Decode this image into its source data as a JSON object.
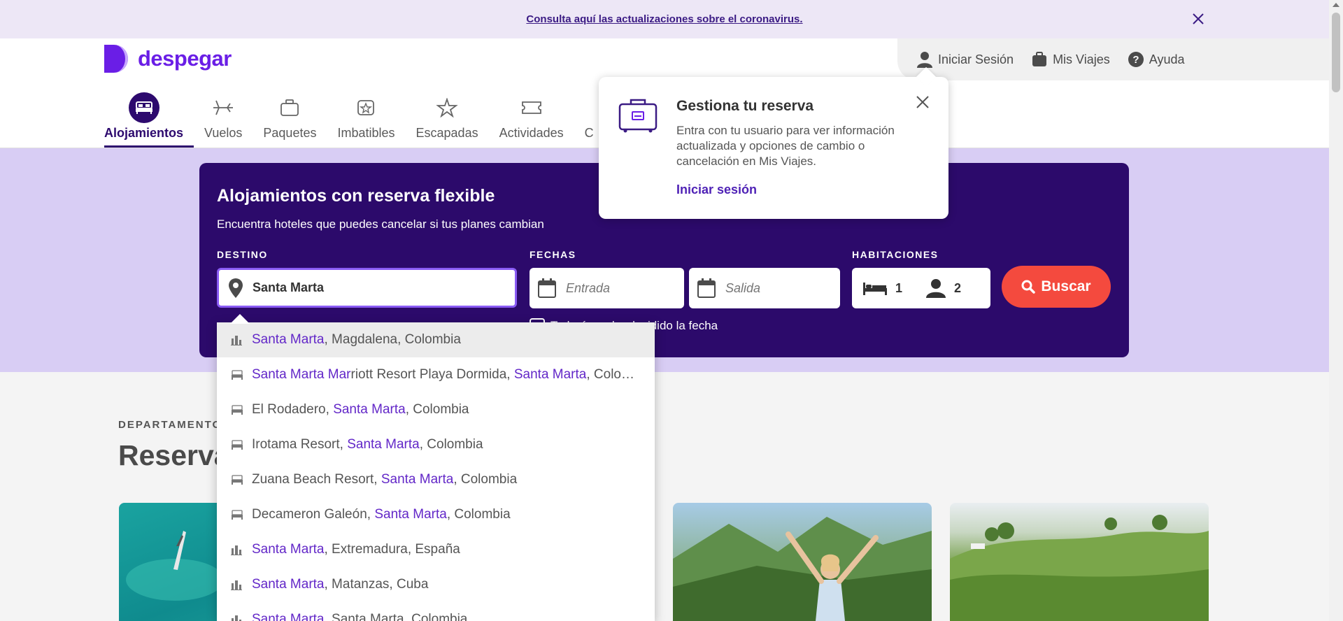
{
  "covid_bar": {
    "link_text": "Consulta aquí las actualizaciones sobre el coronavirus."
  },
  "header": {
    "logo_text": "despegar",
    "user_menu": [
      {
        "label": "Iniciar Sesión",
        "icon": "user-icon"
      },
      {
        "label": "Mis Viajes",
        "icon": "suitcase-icon"
      },
      {
        "label": "Ayuda",
        "icon": "help-icon"
      }
    ],
    "nav": [
      {
        "label": "Alojamientos",
        "icon": "bed-icon",
        "active": true
      },
      {
        "label": "Vuelos",
        "icon": "plane-icon"
      },
      {
        "label": "Paquetes",
        "icon": "package-icon"
      },
      {
        "label": "Imbatibles",
        "icon": "badge-icon"
      },
      {
        "label": "Escapadas",
        "icon": "star-icon"
      },
      {
        "label": "Actividades",
        "icon": "ticket-icon"
      },
      {
        "label": "C",
        "icon": ""
      }
    ]
  },
  "search": {
    "title": "Alojamientos con reserva flexible",
    "subtitle": "Encuentra hoteles que puedes cancelar si tus planes cambian",
    "destination_label": "DESTINO",
    "destination_value": "Santa Marta",
    "dates_label": "FECHAS",
    "checkin_placeholder": "Entrada",
    "checkout_placeholder": "Salida",
    "rooms_label": "HABITACIONES",
    "rooms_count": "1",
    "guests_count": "2",
    "search_button": "Buscar",
    "flexible_date_text": "Todavía no he decidido la fecha"
  },
  "suggestions": [
    {
      "type": "city",
      "hl": "Santa Marta",
      "rest": ", Magdalena, Colombia"
    },
    {
      "type": "hotel",
      "parts": [
        [
          "Santa Marta Mar",
          true
        ],
        [
          "riott Resort Playa Dormida, ",
          false
        ],
        [
          "Santa Marta",
          true
        ],
        [
          ", Colombia",
          false
        ]
      ]
    },
    {
      "type": "hotel",
      "parts": [
        [
          "El Rodadero, ",
          false
        ],
        [
          "Santa Marta",
          true
        ],
        [
          ", Colombia",
          false
        ]
      ]
    },
    {
      "type": "hotel",
      "parts": [
        [
          "Irotama Resort, ",
          false
        ],
        [
          "Santa Marta",
          true
        ],
        [
          ", Colombia",
          false
        ]
      ]
    },
    {
      "type": "hotel",
      "parts": [
        [
          "Zuana Beach Resort, ",
          false
        ],
        [
          "Santa Marta",
          true
        ],
        [
          ", Colombia",
          false
        ]
      ]
    },
    {
      "type": "hotel",
      "parts": [
        [
          "Decameron Galeón, ",
          false
        ],
        [
          "Santa Marta",
          true
        ],
        [
          ", Colombia",
          false
        ]
      ]
    },
    {
      "type": "city",
      "parts": [
        [
          "Santa Marta",
          true
        ],
        [
          ", Extremadura, España",
          false
        ]
      ]
    },
    {
      "type": "city",
      "parts": [
        [
          "Santa Marta",
          true
        ],
        [
          ", Matanzas, Cuba",
          false
        ]
      ]
    },
    {
      "type": "city",
      "parts": [
        [
          "Santa Marta",
          true
        ],
        [
          ", Santa Marta, Colombia",
          false
        ]
      ]
    }
  ],
  "popover": {
    "title": "Gestiona tu reserva",
    "body": "Entra con tu usuario para ver información actualizada y opciones de cambio o cancelación en Mis Viajes.",
    "link": "Iniciar sesión"
  },
  "section": {
    "kicker": "DEPARTAMENTOS",
    "title": "Reserva"
  },
  "colors": {
    "brand_purple": "#6a1ee6",
    "search_box_bg": "#2c0a6b",
    "search_button": "#f44a3e",
    "highlight_text": "#6328c8"
  }
}
